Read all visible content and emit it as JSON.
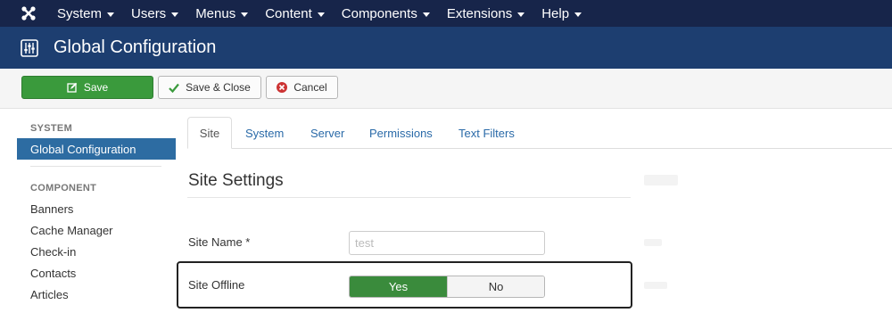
{
  "navbar": {
    "logo_icon": "joomla-logo-icon",
    "items": [
      {
        "label": "System"
      },
      {
        "label": "Users"
      },
      {
        "label": "Menus"
      },
      {
        "label": "Content"
      },
      {
        "label": "Components"
      },
      {
        "label": "Extensions"
      },
      {
        "label": "Help"
      }
    ]
  },
  "header": {
    "icon": "equalizer-icon",
    "title": "Global Configuration"
  },
  "toolbar": {
    "save_label": "Save",
    "save_close_label": "Save & Close",
    "cancel_label": "Cancel"
  },
  "sidebar": {
    "system_heading": "SYSTEM",
    "active_item": "Global Configuration",
    "component_heading": "COMPONENT",
    "items": [
      {
        "label": "Banners"
      },
      {
        "label": "Cache Manager"
      },
      {
        "label": "Check-in"
      },
      {
        "label": "Contacts"
      },
      {
        "label": "Articles"
      }
    ]
  },
  "tabs": [
    {
      "label": "Site"
    },
    {
      "label": "System"
    },
    {
      "label": "Server"
    },
    {
      "label": "Permissions"
    },
    {
      "label": "Text Filters"
    }
  ],
  "main": {
    "section_title": "Site Settings",
    "site_name_label": "Site Name *",
    "site_name_value": "test",
    "site_offline_label": "Site Offline",
    "offline_yes": "Yes",
    "offline_no": "No"
  },
  "colors": {
    "navbar": "#17254a",
    "header": "#1d3e70",
    "save_green": "#3a9a3c",
    "active_blue": "#2d6ca2",
    "link_blue": "#2a6aa8"
  }
}
